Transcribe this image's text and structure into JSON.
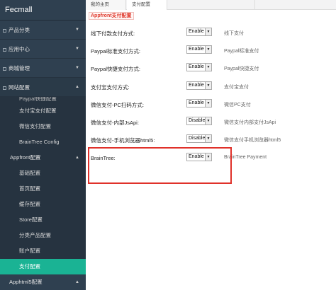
{
  "sidebar": {
    "brand": "Fecmall",
    "top_items": [
      {
        "label": "产品分类"
      },
      {
        "label": "应用中心"
      },
      {
        "label": "商城管理"
      },
      {
        "label": "网站配置"
      }
    ],
    "partial_item": "Paypal快捷配置",
    "sub_items_1": [
      {
        "label": "支付宝支付配置"
      },
      {
        "label": "微信支付配置"
      },
      {
        "label": "BrainTree Config"
      }
    ],
    "group": "Appfront配置",
    "sub_items_2": [
      {
        "label": "基础配置"
      },
      {
        "label": "首页配置"
      },
      {
        "label": "缓存配置"
      },
      {
        "label": "Store配置"
      },
      {
        "label": "分类产品配置"
      },
      {
        "label": "账户配置"
      },
      {
        "label": "支付配置"
      }
    ],
    "bottom_item": "Apphtml5配置"
  },
  "tabs": {
    "home": "我的主页",
    "active": "支付配置"
  },
  "content": {
    "section_title": "Appfront支付配置",
    "rows": [
      {
        "label": "线下付款支付方式:",
        "value": "Enable",
        "desc": "线下支付"
      },
      {
        "label": "Paypal标准支付方式:",
        "value": "Enable",
        "desc": "Paypal标准支付"
      },
      {
        "label": "Paypal快捷支付方式:",
        "value": "Enable",
        "desc": "Paypal快捷支付"
      },
      {
        "label": "支付宝支付方式:",
        "value": "Enable",
        "desc": "支付宝支付"
      },
      {
        "label": "微信支付-PC扫码方式:",
        "value": "Enable",
        "desc": "微信PC支付"
      },
      {
        "label": "微信支付-内部JsApi:",
        "value": "Disable",
        "desc": "微信支付内部支付JsApi"
      },
      {
        "label": "微信支付-手机浏览器html5:",
        "value": "Disable",
        "desc": "微信支付手机浏览器html5"
      },
      {
        "label": "BrainTree:",
        "value": "Enable",
        "desc": "BrainTree Payment"
      }
    ]
  },
  "colors": {
    "sidebar_bg": "#2f4050",
    "active_green": "#1ab394",
    "highlight_red": "#e0312a"
  }
}
